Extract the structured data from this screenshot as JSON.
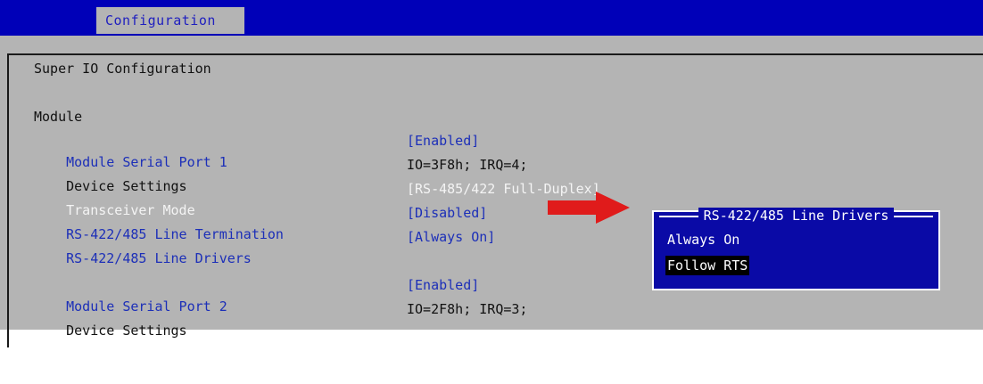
{
  "header": {
    "tab_label": "Configuration"
  },
  "page": {
    "title": "Super IO Configuration",
    "section": "Module"
  },
  "settings": {
    "port1": {
      "label": "Module Serial Port 1",
      "value": "[Enabled]"
    },
    "device1": {
      "label": "Device Settings",
      "value": "IO=3F8h; IRQ=4;"
    },
    "transceiver": {
      "label": "Transceiver Mode",
      "value": "[RS-485/422 Full-Duplex]"
    },
    "termination": {
      "label": "RS-422/485 Line Termination",
      "value": "[Disabled]"
    },
    "drivers": {
      "label": "RS-422/485 Line Drivers",
      "value": "[Always On]"
    },
    "port2": {
      "label": "Module Serial Port 2",
      "value": "[Enabled]"
    },
    "device2": {
      "label": "Device Settings",
      "value": "IO=2F8h; IRQ=3;"
    }
  },
  "popup": {
    "title": "RS-422/485 Line Drivers",
    "options": [
      "Always On",
      "Follow RTS"
    ],
    "selected": "Follow RTS"
  },
  "colors": {
    "bios_blue": "#0000b8",
    "panel_gray": "#b4b4b4",
    "link_blue": "#1c2fb8",
    "arrow_red": "#e01b1b"
  },
  "icons": {
    "pointer": "red-arrow-icon"
  }
}
